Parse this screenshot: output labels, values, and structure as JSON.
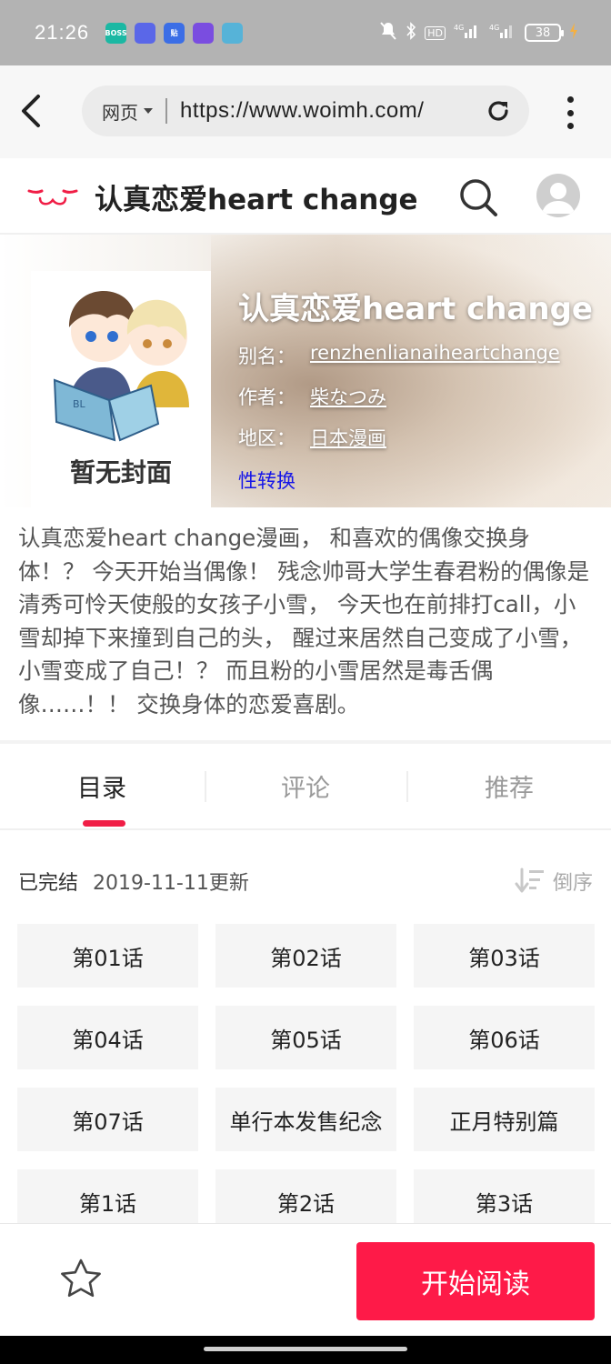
{
  "status_bar": {
    "time": "21:26",
    "apps": [
      {
        "name": "boss-app-icon",
        "label": "BOSS",
        "color": "#1bb8a3"
      },
      {
        "name": "weather-app-icon",
        "label": "",
        "color": "#5a67e8"
      },
      {
        "name": "tieba-app-icon",
        "label": "贴",
        "color": "#3b6ee6"
      },
      {
        "name": "purple-app-icon",
        "label": "",
        "color": "#7a4de0"
      },
      {
        "name": "box-app-icon",
        "label": "",
        "color": "#56b3d8"
      }
    ],
    "network": "4G",
    "battery": "38"
  },
  "browser": {
    "mode_label": "网页",
    "url": "https://www.woimh.com/"
  },
  "site": {
    "title": "认真恋爱heart change"
  },
  "comic": {
    "title": "认真恋爱heart change",
    "alias_label": "别名：",
    "alias": "renzhenlianaiheartchange",
    "author_label": "作者：",
    "author": "柴なつみ",
    "region_label": "地区：",
    "region": "日本漫画",
    "tag": "性转换",
    "cover_text": "暂无封面",
    "description": "认真恋爱heart change漫画， 和喜欢的偶像交换身体！？ 今天开始当偶像！ 残念帅哥大学生春君粉的偶像是清秀可怜天使般的女孩子小雪， 今天也在前排打call，小雪却掉下来撞到自己的头， 醒过来居然自己变成了小雪，小雪变成了自己！？ 而且粉的小雪居然是毒舌偶像……！！ 交换身体的恋爱喜剧。"
  },
  "tabs": [
    {
      "label": "目录",
      "active": true
    },
    {
      "label": "评论",
      "active": false
    },
    {
      "label": "推荐",
      "active": false
    }
  ],
  "chapters_meta": {
    "status": "已完结",
    "updated": "2019-11-11更新",
    "sort_label": "倒序"
  },
  "chapters": [
    "第01话",
    "第02话",
    "第03话",
    "第04话",
    "第05话",
    "第06话",
    "第07话",
    "单行本发售纪念",
    "正月特别篇",
    "第1话",
    "第2话",
    "第3话"
  ],
  "actions": {
    "read_label": "开始阅读"
  },
  "colors": {
    "accent": "#fe1a48",
    "tag": "#1616e8",
    "status_bar": "#b3b3b3"
  }
}
